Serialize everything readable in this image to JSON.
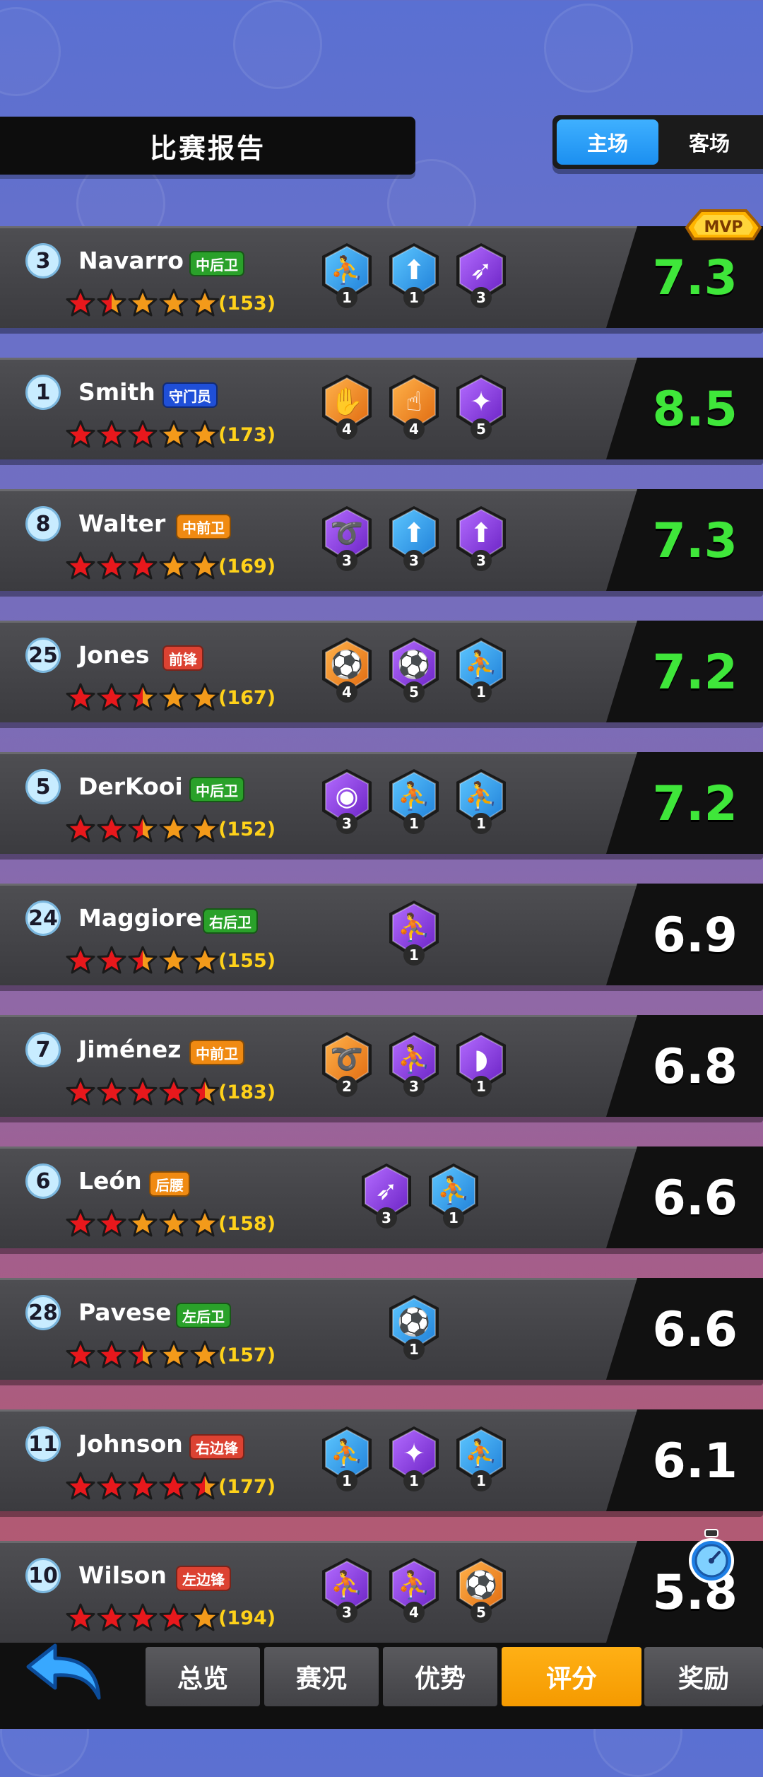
{
  "header": {
    "title": "比赛报告"
  },
  "toggle": {
    "home": "主场",
    "away": "客场"
  },
  "mvp_label": "MVP",
  "players": [
    {
      "number": "3",
      "name": "Navarro",
      "position": "中后卫",
      "pos_color": "green",
      "stars": [
        2,
        1,
        0,
        0,
        0
      ],
      "count": "(153)",
      "score": "7.3",
      "score_color": "green",
      "badges": [
        {
          "color": "blue",
          "glyph": "⛹",
          "n": "1"
        },
        {
          "color": "blue",
          "glyph": "⬆",
          "n": "1"
        },
        {
          "color": "purple",
          "glyph": "➶",
          "n": "3"
        }
      ]
    },
    {
      "number": "1",
      "name": "Smith",
      "position": "守门员",
      "pos_color": "blue",
      "stars": [
        2,
        2,
        2,
        0,
        0
      ],
      "count": "(173)",
      "score": "8.5",
      "score_color": "green",
      "badges": [
        {
          "color": "orange",
          "glyph": "✋",
          "n": "4"
        },
        {
          "color": "orange",
          "glyph": "☝",
          "n": "4"
        },
        {
          "color": "purple",
          "glyph": "✦",
          "n": "5"
        }
      ]
    },
    {
      "number": "8",
      "name": "Walter",
      "position": "中前卫",
      "pos_color": "orange",
      "stars": [
        2,
        2,
        2,
        0,
        0
      ],
      "count": "(169)",
      "score": "7.3",
      "score_color": "green",
      "badges": [
        {
          "color": "purple",
          "glyph": "➰",
          "n": "3"
        },
        {
          "color": "blue",
          "glyph": "⬆",
          "n": "3"
        },
        {
          "color": "purple",
          "glyph": "⬆",
          "n": "3"
        }
      ]
    },
    {
      "number": "25",
      "name": "Jones",
      "position": "前锋",
      "pos_color": "red",
      "stars": [
        2,
        2,
        1,
        0,
        0
      ],
      "count": "(167)",
      "score": "7.2",
      "score_color": "green",
      "badges": [
        {
          "color": "orange",
          "glyph": "⚽",
          "n": "4"
        },
        {
          "color": "purple",
          "glyph": "⚽",
          "n": "5"
        },
        {
          "color": "blue",
          "glyph": "⛹",
          "n": "1"
        }
      ]
    },
    {
      "number": "5",
      "name": "DerKooi",
      "position": "中后卫",
      "pos_color": "green",
      "stars": [
        2,
        2,
        1,
        0,
        0
      ],
      "count": "(152)",
      "score": "7.2",
      "score_color": "green",
      "badges": [
        {
          "color": "purple",
          "glyph": "◉",
          "n": "3"
        },
        {
          "color": "blue",
          "glyph": "⛹",
          "n": "1"
        },
        {
          "color": "blue",
          "glyph": "⛹",
          "n": "1"
        }
      ]
    },
    {
      "number": "24",
      "name": "Maggiore",
      "position": "右后卫",
      "pos_color": "green",
      "stars": [
        2,
        2,
        1,
        0,
        0
      ],
      "count": "(155)",
      "score": "6.9",
      "score_color": "white",
      "badges": [
        {
          "color": "purple",
          "glyph": "⛹",
          "n": "1"
        }
      ]
    },
    {
      "number": "7",
      "name": "Jiménez",
      "position": "中前卫",
      "pos_color": "orange",
      "stars": [
        2,
        2,
        2,
        2,
        1
      ],
      "count": "(183)",
      "score": "6.8",
      "score_color": "white",
      "badges": [
        {
          "color": "orange",
          "glyph": "➰",
          "n": "2"
        },
        {
          "color": "purple",
          "glyph": "⛹",
          "n": "3"
        },
        {
          "color": "purple",
          "glyph": "◗",
          "n": "1"
        }
      ]
    },
    {
      "number": "6",
      "name": "León",
      "position": "后腰",
      "pos_color": "orange",
      "stars": [
        2,
        2,
        0,
        0,
        0
      ],
      "count": "(158)",
      "score": "6.6",
      "score_color": "white",
      "badges": [
        {
          "color": "purple",
          "glyph": "➶",
          "n": "3"
        },
        {
          "color": "blue",
          "glyph": "⛹",
          "n": "1"
        }
      ]
    },
    {
      "number": "28",
      "name": "Pavese",
      "position": "左后卫",
      "pos_color": "green",
      "stars": [
        2,
        2,
        1,
        0,
        0
      ],
      "count": "(157)",
      "score": "6.6",
      "score_color": "white",
      "badges": [
        {
          "color": "blue",
          "glyph": "⚽",
          "n": "1"
        }
      ]
    },
    {
      "number": "11",
      "name": "Johnson",
      "position": "右边锋",
      "pos_color": "red",
      "stars": [
        2,
        2,
        2,
        2,
        1
      ],
      "count": "(177)",
      "score": "6.1",
      "score_color": "white",
      "badges": [
        {
          "color": "blue",
          "glyph": "⛹",
          "n": "1"
        },
        {
          "color": "purple",
          "glyph": "✦",
          "n": "1"
        },
        {
          "color": "blue",
          "glyph": "⛹",
          "n": "1"
        }
      ]
    },
    {
      "number": "10",
      "name": "Wilson",
      "position": "左边锋",
      "pos_color": "red",
      "stars": [
        2,
        2,
        2,
        2,
        0
      ],
      "count": "(194)",
      "score": "5.8",
      "score_color": "white",
      "badges": [
        {
          "color": "purple",
          "glyph": "⛹",
          "n": "3"
        },
        {
          "color": "purple",
          "glyph": "⛹",
          "n": "4"
        },
        {
          "color": "orange",
          "glyph": "⚽",
          "n": "5"
        }
      ]
    }
  ],
  "tabs": [
    {
      "label": "总览",
      "active": false
    },
    {
      "label": "赛况",
      "active": false
    },
    {
      "label": "优势",
      "active": false
    },
    {
      "label": "评分",
      "active": true
    },
    {
      "label": "奖励",
      "active": false
    }
  ],
  "colors": {
    "blue_badge": "#2f9fe8",
    "purple_badge": "#8a3ee0",
    "orange_badge": "#f18a1e",
    "star_red": "#e8181c",
    "star_orange": "#f39a1a",
    "score_green": "#3fe63a"
  }
}
